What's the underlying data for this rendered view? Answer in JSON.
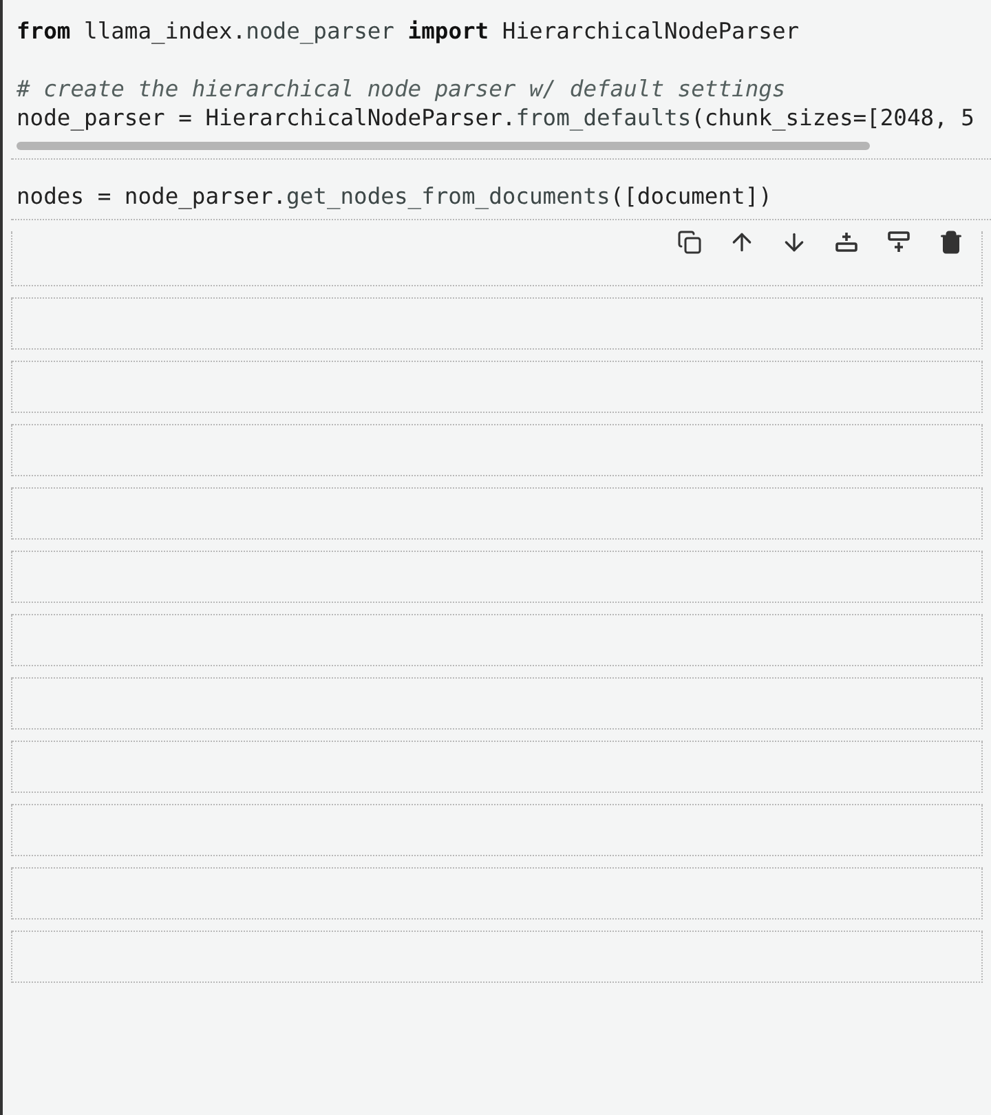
{
  "cells": [
    {
      "kind": "code",
      "selected": false,
      "scrollbar": true,
      "blocks": [
        [
          [
            {
              "text": "from",
              "kind": "keyword"
            },
            {
              "text": " llama_index.",
              "kind": "plain"
            },
            {
              "text": "node_parser",
              "kind": "attr"
            },
            {
              "text": " import",
              "kind": "keyword"
            },
            {
              "text": " HierarchicalNodeParser",
              "kind": "plain"
            }
          ]
        ],
        [
          [
            {
              "text": "# create the hierarchical node parser w/ default settings",
              "kind": "comment"
            }
          ],
          [
            {
              "text": "node_parser = HierarchicalNodeParser.",
              "kind": "plain"
            },
            {
              "text": "from_defaults",
              "kind": "attr"
            },
            {
              "text": "(chunk_sizes=[2048, 5",
              "kind": "plain"
            }
          ]
        ]
      ]
    },
    {
      "kind": "code",
      "selected": false,
      "scrollbar": false,
      "blocks": [
        [
          [
            {
              "text": "nodes = node_parser.",
              "kind": "plain"
            },
            {
              "text": "get_nodes_from_documents",
              "kind": "attr"
            },
            {
              "text": "([document])",
              "kind": "plain"
            }
          ]
        ]
      ]
    },
    {
      "kind": "empty",
      "selected": true
    },
    {
      "kind": "empty",
      "selected": false
    },
    {
      "kind": "empty",
      "selected": false
    },
    {
      "kind": "empty",
      "selected": false
    },
    {
      "kind": "empty",
      "selected": false
    },
    {
      "kind": "empty",
      "selected": false
    },
    {
      "kind": "empty",
      "selected": false
    },
    {
      "kind": "empty",
      "selected": false
    },
    {
      "kind": "empty",
      "selected": false
    },
    {
      "kind": "empty",
      "selected": false
    },
    {
      "kind": "empty",
      "selected": false
    },
    {
      "kind": "empty",
      "selected": false
    }
  ]
}
